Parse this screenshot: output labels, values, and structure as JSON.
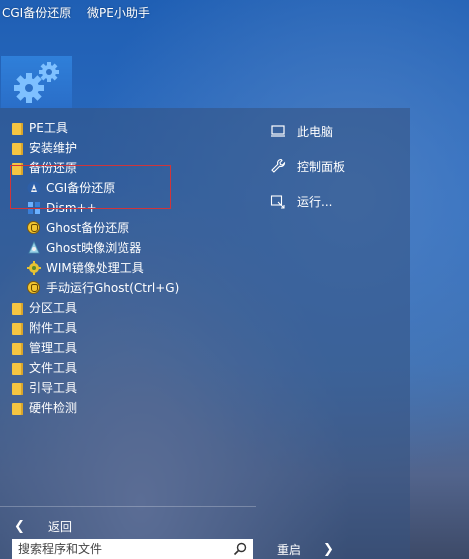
{
  "taskbar": {
    "apps": [
      "CGI备份还原",
      "微PE小助手"
    ]
  },
  "menu": {
    "left_items": [
      {
        "label": "PE工具",
        "icon": "folder-icon",
        "level": 0
      },
      {
        "label": "安装维护",
        "icon": "folder-icon",
        "level": 0
      },
      {
        "label": "备份还原",
        "icon": "folder-icon",
        "level": 0
      },
      {
        "label": "CGI备份还原",
        "icon": "cgi-icon",
        "level": 1
      },
      {
        "label": "Dism++",
        "icon": "dism-icon",
        "level": 1
      },
      {
        "label": "Ghost备份还原",
        "icon": "ghost-icon",
        "level": 1
      },
      {
        "label": "Ghost映像浏览器",
        "icon": "ghost-explorer-icon",
        "level": 1
      },
      {
        "label": "WIM镜像处理工具",
        "icon": "wim-icon",
        "level": 1
      },
      {
        "label": "手动运行Ghost(Ctrl+G)",
        "icon": "ghost-icon",
        "level": 1
      },
      {
        "label": "分区工具",
        "icon": "folder-icon",
        "level": 0
      },
      {
        "label": "附件工具",
        "icon": "folder-icon",
        "level": 0
      },
      {
        "label": "管理工具",
        "icon": "folder-icon",
        "level": 0
      },
      {
        "label": "文件工具",
        "icon": "folder-icon",
        "level": 0
      },
      {
        "label": "引导工具",
        "icon": "folder-icon",
        "level": 0
      },
      {
        "label": "硬件检测",
        "icon": "folder-icon",
        "level": 0
      }
    ],
    "right_items": [
      {
        "label": "此电脑",
        "icon": "computer-icon"
      },
      {
        "label": "控制面板",
        "icon": "wrench-icon"
      },
      {
        "label": "运行...",
        "icon": "run-icon"
      }
    ],
    "back_label": "返回",
    "search_placeholder": "搜索程序和文件",
    "restart_label": "重启"
  }
}
